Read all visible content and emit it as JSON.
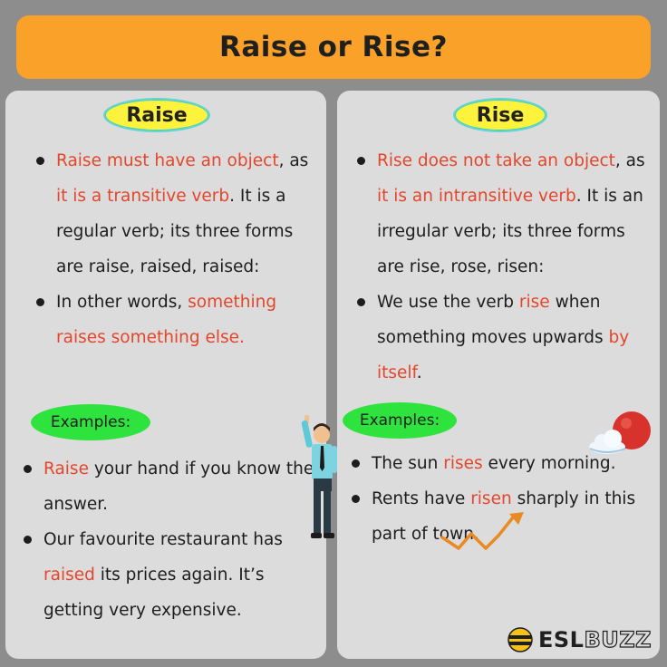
{
  "title": "Raise or Rise?",
  "left": {
    "heading": "Raise",
    "points": [
      {
        "parts": [
          {
            "t": "Raise must have an object",
            "red": true
          },
          {
            "t": ", as ",
            "red": false
          },
          {
            "t": "it is a transitive verb",
            "red": true
          },
          {
            "t": ". It is a regular verb; its three forms are raise, raised, raised:",
            "red": false
          }
        ]
      },
      {
        "parts": [
          {
            "t": " In other words, ",
            "red": false
          },
          {
            "t": "something raises something else.",
            "red": true
          }
        ]
      }
    ],
    "examples_label": "Examples:",
    "examples": [
      {
        "parts": [
          {
            "t": "Raise",
            "red": true
          },
          {
            "t": " your hand if you know the answer.",
            "red": false
          }
        ]
      },
      {
        "parts": [
          {
            "t": "Our favourite restaurant has ",
            "red": false
          },
          {
            "t": "raised",
            "red": true
          },
          {
            "t": " its prices again. It’s getting very expensive.",
            "red": false
          }
        ]
      }
    ]
  },
  "right": {
    "heading": "Rise",
    "points": [
      {
        "parts": [
          {
            "t": "Rise does not take an object",
            "red": true
          },
          {
            "t": ", as ",
            "red": false
          },
          {
            "t": "it is an intransitive verb",
            "red": true
          },
          {
            "t": ". It is an irregular verb; its three forms are rise, rose, risen:",
            "red": false
          }
        ]
      },
      {
        "parts": [
          {
            "t": " We use the verb ",
            "red": false
          },
          {
            "t": "rise",
            "red": true
          },
          {
            "t": " when something moves upwards ",
            "red": false
          },
          {
            "t": "by itself",
            "red": true
          },
          {
            "t": ".",
            "red": false
          }
        ]
      }
    ],
    "examples_label": "Examples:",
    "examples": [
      {
        "parts": [
          {
            "t": "The sun ",
            "red": false
          },
          {
            "t": "rises",
            "red": true
          },
          {
            "t": " every morning.",
            "red": false
          }
        ]
      },
      {
        "parts": [
          {
            "t": "Rents have ",
            "red": false
          },
          {
            "t": "risen",
            "red": true
          },
          {
            "t": " sharply in this part of town.",
            "red": false
          }
        ]
      }
    ]
  },
  "brand": {
    "bold": "ESL",
    "light": "BUZZ"
  },
  "colors": {
    "background": "#8d8d8d",
    "banner": "#f9a128",
    "panel": "#dcdcdc",
    "heading_pill": "#fdf33c",
    "examples_pill": "#2fe33f",
    "highlight": "#e3462b"
  },
  "icons": [
    "raising-hand-person-icon",
    "sun-cloud-icon",
    "rising-trend-arrow-icon",
    "bee-logo-icon"
  ]
}
